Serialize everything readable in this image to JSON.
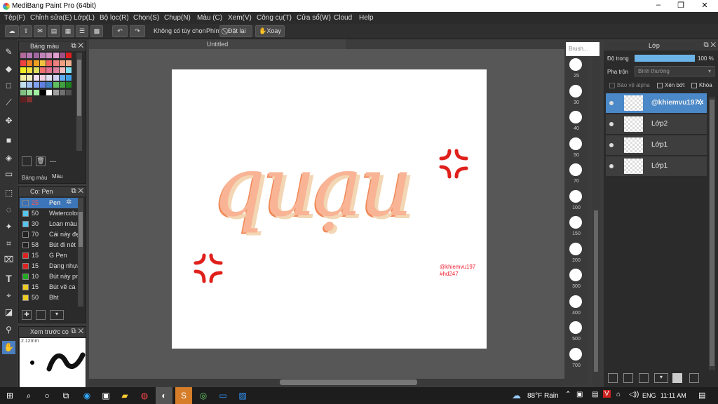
{
  "window": {
    "title": "MediBang Paint Pro (64bit)",
    "min": "–",
    "max": "❐",
    "close": "✕"
  },
  "menu": [
    "Tệp(F)",
    "Chỉnh sửa(E)",
    "Lớp(L)",
    "Bộ lọc(R)",
    "Chọn(S)",
    "Chụp(N)",
    "Màu (C)",
    "Xem(V)",
    "Công cụ(T)",
    "Cửa sổ(W)",
    "Cloud",
    "Help"
  ],
  "toolbar": {
    "no_option": "Không có tùy chọn",
    "phim": "Phím",
    "reset": "Đặt lại",
    "rotate": "Xoay"
  },
  "palette": {
    "title": "Bảng màu",
    "tab1": "Bảng màu",
    "tab2": "Màu",
    "field": "---"
  },
  "brush": {
    "title": "Cọ: Pen",
    "items": [
      {
        "size": "25",
        "name": "Pen",
        "color": "#3b6fb5"
      },
      {
        "size": "50",
        "name": "Watercolor",
        "color": "#55c7ee"
      },
      {
        "size": "30",
        "name": "Loan màu",
        "color": "#55c7ee"
      },
      {
        "size": "70",
        "name": "Cái này đẹp",
        "color": "#222222"
      },
      {
        "size": "58",
        "name": "Bút đi nét",
        "color": "#222222"
      },
      {
        "size": "15",
        "name": "G Pen",
        "color": "#dd2222"
      },
      {
        "size": "15",
        "name": "Dạng nhựa",
        "color": "#dd2222"
      },
      {
        "size": "10",
        "name": "Bút này pr",
        "color": "#22aa22"
      },
      {
        "size": "15",
        "name": "Bút vẽ ca",
        "color": "#eecc22"
      },
      {
        "size": "50",
        "name": "Bht",
        "color": "#eecc22"
      }
    ]
  },
  "preview": {
    "title": "Xem trước cọ",
    "size": "2.12mm"
  },
  "document": {
    "tab": "Untitled",
    "text": "quạu",
    "watermark1": "@khiemvu197",
    "watermark2": "#hd247"
  },
  "brushsize": {
    "title": "Brush...",
    "sizes": [
      "25",
      "30",
      "40",
      "50",
      "70",
      "100",
      "150",
      "200",
      "300",
      "400",
      "500",
      "700"
    ]
  },
  "layers": {
    "title": "Lớp",
    "opacity_label": "Độ trong",
    "opacity": "100 %",
    "opacity_value": 1.0,
    "blend_label": "Pha trộn",
    "blend": "Bình thường",
    "protect_alpha": "Bảo vệ alpha",
    "clip": "Xén bớt",
    "lock": "Khóa",
    "items": [
      {
        "name": "@khiemvu197",
        "selected": true
      },
      {
        "name": "Lớp2",
        "selected": false
      },
      {
        "name": "Lớp1",
        "selected": false
      },
      {
        "name": "Lớp1",
        "selected": false
      }
    ]
  },
  "taskbar": {
    "weather": "88°F Rain",
    "lang": "ENG",
    "time": "11:11 AM"
  }
}
